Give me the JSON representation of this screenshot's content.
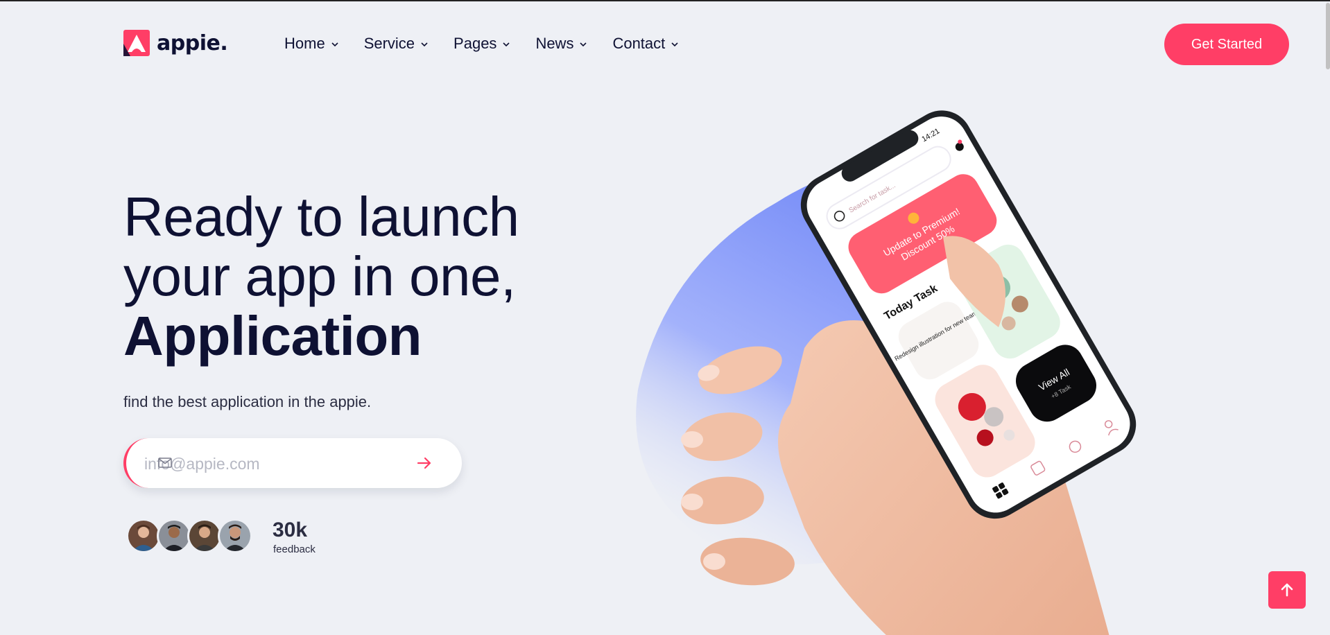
{
  "header": {
    "logo_text": "appie.",
    "nav": [
      {
        "label": "Home"
      },
      {
        "label": "Service"
      },
      {
        "label": "Pages"
      },
      {
        "label": "News"
      },
      {
        "label": "Contact"
      }
    ],
    "cta_label": "Get Started"
  },
  "hero": {
    "title_line1": "Ready to launch",
    "title_line2": "your app in one,",
    "title_line3": "Application",
    "subtitle": "find the best application in the appie."
  },
  "subscribe": {
    "placeholder": "info@appie.com"
  },
  "feedback": {
    "count": "30k",
    "label": "feedback"
  },
  "phone": {
    "time": "14:21",
    "search_placeholder": "Search for task...",
    "promo_line1": "Update to Premium!",
    "promo_line2": "Discount 50%",
    "section_title": "Today Task",
    "task_card": "Redesign illustration for new team",
    "view_all": "View All",
    "view_all_sub": "+8 Task"
  },
  "colors": {
    "accent": "#ff3e66",
    "background": "#eef0f5",
    "text": "#0e1133",
    "blob": "#7b8ff7"
  },
  "icons": {
    "logo": "appie-logo-icon",
    "chevron": "chevron-down-icon",
    "mail": "mail-icon",
    "send": "arrow-right-icon",
    "back_to_top": "arrow-up-icon"
  }
}
